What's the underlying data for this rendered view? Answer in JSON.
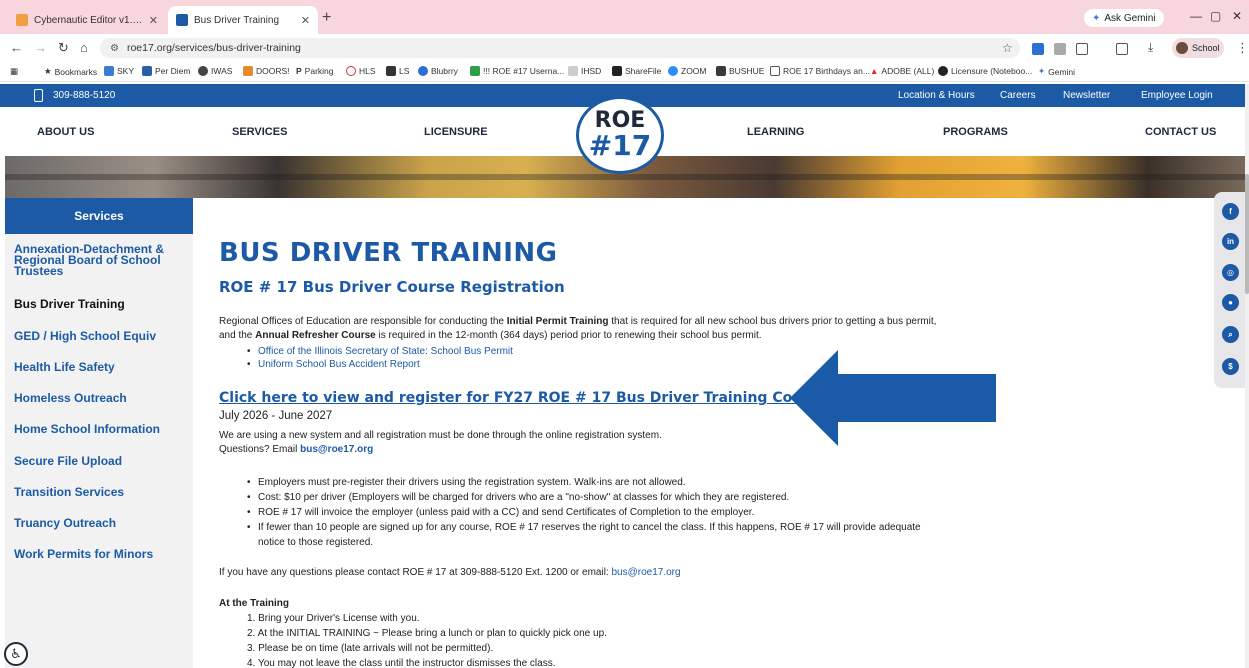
{
  "browser": {
    "tabs": [
      {
        "title": "Cybernautic Editor v1.20.2 | ser",
        "active": false
      },
      {
        "title": "Bus Driver Training",
        "active": true
      }
    ],
    "new_tab": "+",
    "ask_gemini": "Ask Gemini",
    "url": "roe17.org/services/bus-driver-training",
    "profile": "School",
    "bookmarks": [
      "Bookmarks",
      "SKY",
      "Per Diem",
      "IWAS",
      "DOORS!",
      "Parking",
      "HLS",
      "LS",
      "Blubrry",
      "!!! ROE #17 Userna...",
      "IHSD",
      "ShareFile",
      "ZOOM",
      "BUSHUE",
      "ROE 17 Birthdays an...",
      "ADOBE (ALL)",
      "Licensure (Noteboo...",
      "Gemini"
    ]
  },
  "site": {
    "phone": "309-888-5120",
    "top_links": [
      "Location & Hours",
      "Careers",
      "Newsletter",
      "Employee Login"
    ],
    "nav": [
      "ABOUT US",
      "SERVICES",
      "LICENSURE",
      "LEARNING",
      "PROGRAMS",
      "CONTACT US"
    ],
    "logo": {
      "line1": "ROE",
      "line2": "#17"
    }
  },
  "sidebar": {
    "heading": "Services",
    "items": [
      "Annexation-Detachment & Regional Board of School Trustees",
      "Bus Driver Training",
      "GED / High School Equiv",
      "Health Life Safety",
      "Homeless Outreach",
      "Home School Information",
      "Secure File Upload",
      "Transition Services",
      "Truancy Outreach",
      "Work Permits for Minors"
    ],
    "active_index": 1
  },
  "main": {
    "title": "BUS DRIVER TRAINING",
    "subtitle": "ROE # 17 Bus Driver Course Registration",
    "intro": {
      "p1": "Regional Offices of Education are responsible for conducting the ",
      "b1": "Initial Permit Training",
      "p2": " that is required for all new school bus drivers prior to getting a bus permit, and the ",
      "b2": "Annual Refresher Course",
      "p3": " is required in the 12-month (364 days) period prior to renewing their school bus permit."
    },
    "links": [
      "Office of the Illinois Secretary of State: School Bus Permit",
      "Uniform School Bus Accident Report"
    ],
    "register_link": "Click here to view and register for FY27 ROE # 17 Bus Driver Training Courses",
    "date_range": "July 2026 - June 2027",
    "system_note": "We are using a new system and all registration must be done through the online registration system.",
    "questions_prefix": "Questions? Email ",
    "questions_email": "bus@roe17.org",
    "bullets": [
      "Employers must pre-register their drivers using the registration system. Walk-ins are not allowed.",
      "Cost: $10 per driver (Employers will be charged for drivers who are a \"no-show\" at classes for which they are registered.",
      "ROE # 17 will invoice the employer (unless paid with a CC) and send Certificates of Completion to the employer.",
      "If fewer than 10 people are signed up for any course, ROE # 17 reserves the right to cancel the class. If this happens, ROE # 17 will provide adequate notice to those registered."
    ],
    "contact_prefix": "If you have any questions please contact ROE # 17 at 309-888-5120 Ext. 1200 or email: ",
    "contact_email": "bus@roe17.org",
    "training_heading": "At the Training",
    "training_steps": [
      "1. Bring your Driver's License with you.",
      "2. At the INITIAL TRAINING ~ Please bring a lunch or plan to quickly pick one up.",
      "3. Please be on time (late arrivals will not be permitted).",
      "4. You may not leave the class until the instructor dismisses the class."
    ]
  },
  "social": [
    "f",
    "in",
    "ig",
    "mic",
    "search",
    "$"
  ],
  "colors": {
    "brand_blue": "#1c5aa6",
    "arrow_blue": "#1a5aa8",
    "tabbar_pink": "#f7d7dd"
  }
}
